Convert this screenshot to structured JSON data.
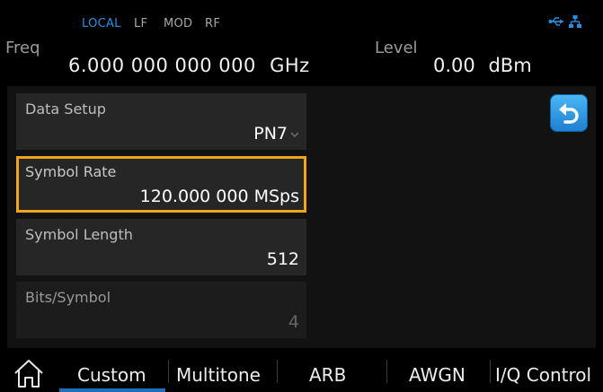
{
  "status_bar": {
    "modes": [
      {
        "label": "LOCAL",
        "active": true
      },
      {
        "label": "LF",
        "active": false
      },
      {
        "label": "MOD",
        "active": false
      },
      {
        "label": "RF",
        "active": false
      }
    ],
    "icons": [
      "usb-icon",
      "network-icon"
    ],
    "accent_color": "#2a8fe0"
  },
  "freq": {
    "label": "Freq",
    "value": "6.000 000 000 000",
    "unit": "GHz"
  },
  "level": {
    "label": "Level",
    "value": "0.00",
    "unit": "dBm"
  },
  "fields": [
    {
      "label": "Data Setup",
      "value": "PN7",
      "type": "dropdown"
    },
    {
      "label": "Symbol Rate",
      "value": "120.000 000 MSps",
      "selected": true
    },
    {
      "label": "Symbol Length",
      "value": "512"
    },
    {
      "label": "Bits/Symbol",
      "value": "4",
      "disabled": true
    }
  ],
  "highlight_color": "#f2a51c",
  "back_button": {
    "icon": "back-arrow-icon"
  },
  "tabs": [
    {
      "label": "Custom",
      "active": true
    },
    {
      "label": "Multitone"
    },
    {
      "label": "ARB"
    },
    {
      "label": "AWGN"
    },
    {
      "label": "I/Q Control"
    }
  ],
  "home_icon": "home-icon"
}
